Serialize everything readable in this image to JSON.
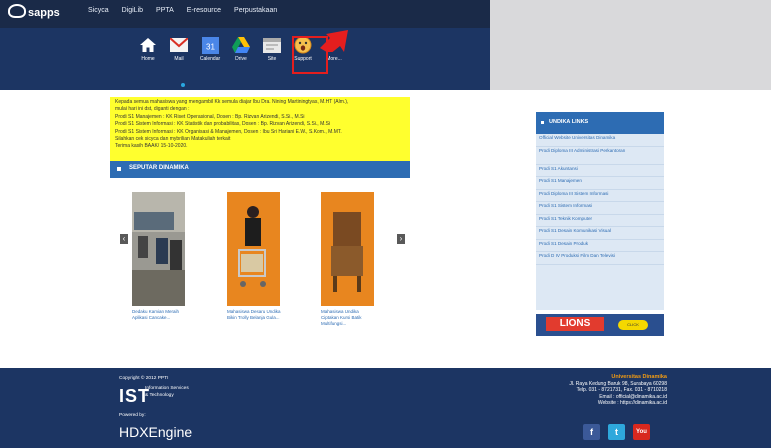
{
  "brand": {
    "logo": "sapps"
  },
  "topnav": [
    "Sicyca",
    "DigiLib",
    "PPTA",
    "E-resource",
    "Perpustakaan"
  ],
  "apps": [
    {
      "label": "Home",
      "icon": "home-icon"
    },
    {
      "label": "Mail",
      "icon": "mail-icon"
    },
    {
      "label": "Calendar",
      "icon": "calendar-icon",
      "glyph": "31"
    },
    {
      "label": "Drive",
      "icon": "drive-icon"
    },
    {
      "label": "Site",
      "icon": "site-icon"
    },
    {
      "label": "Support",
      "icon": "support-icon"
    },
    {
      "label": "More...",
      "icon": "more-icon",
      "glyph": "»"
    }
  ],
  "notice": {
    "lines": [
      "Kepada semua mahasiswa yang mengambil Kk semula diajar Ibu Dra. Nining Martiningtyas, M.HT (Alm.),",
      "mulai hari ini dst, diganti dengan :",
      "Prodi S1 Manajemen : KK Riset Operasional, Dosen : Bp. Rizvan Arizendi, S.Si., M.Si",
      "Prodi S1 Sistem Informasi : KK Statistik dan probabilitas, Dosen : Bp. Rizvan Arizendi, S.Si., M.Si",
      "Prodi S1 Sistem Informasi : KK Organisasi & Manajemen, Dosen : Ibu Sri Hariani E.W., S.Kom., M.MT.",
      "Silahkan cek sicyca dan mybrilian Matakuliah terkait",
      "Terima kasih BAAK/ 15-10-2020."
    ]
  },
  "news": {
    "title": "SEPUTAR DINAMIKA",
    "captions": [
      "Dedaku Kamian Meraih Aplikasi Cancake...",
      "Mahasiswa Desaru Undika Bikin Trolly Belanja Gula...",
      "Mahasiswa Undika Ciptakan Kursi Batik Multifungsi..."
    ]
  },
  "links": {
    "title": "UNDIKA LINKS",
    "items": [
      "Official Website Universitas Dinamika",
      "Prodi Diploma III Administrasi Perkantoran",
      "Prodi S1 Akuntansi",
      "Prodi S1 Manajemen",
      "Prodi Diploma III Sistem Informasi",
      "Prodi S1 Sistem Informasi",
      "Prodi S1 Teknik Komputer",
      "Prodi S1 Desain Komunikasi Visual",
      "Prodi S1 Desain Produk",
      "Prodi D IV Produksi Film Dan Televisi"
    ]
  },
  "lions": {
    "name": "LIONS",
    "button": "CLICK"
  },
  "footer": {
    "copyright": "Copyright © 2012 PPTI",
    "ist": "IST",
    "ist_sub1": "Information Services",
    "ist_sub2": "& Technology",
    "powered": "Powered by:",
    "engine": "HDXEngine",
    "univ_name": "Universitas Dinamika",
    "addr1": "Jl. Raya Kedung Baruk 98, Surabaya 60298",
    "addr2": "Telp. 031 - 8721731, Fax. 031 - 8710218",
    "addr3": "Email : official@dinamika.ac.id",
    "addr4": "Website : https://dinamika.ac.id"
  },
  "social": [
    {
      "glyph": "f",
      "color": "#3b5998",
      "icon": "facebook-icon"
    },
    {
      "glyph": "t",
      "color": "#2ea8dc",
      "icon": "twitter-icon"
    },
    {
      "glyph": "You",
      "color": "#d8281e",
      "icon": "youtube-icon"
    }
  ],
  "colors": {
    "header": "#1c3563",
    "accent": "#2d6cb3",
    "notice": "#ffff2e",
    "highlight": "#e41e1e"
  }
}
